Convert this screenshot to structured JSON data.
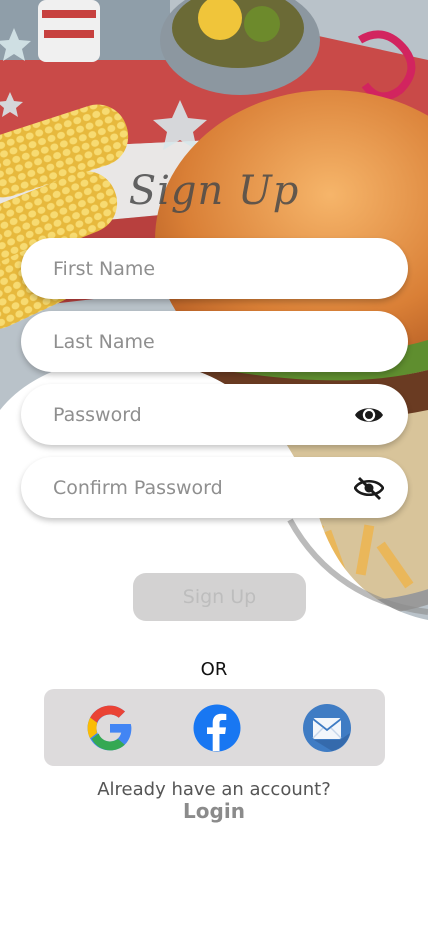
{
  "title": "Sign Up",
  "form": {
    "first_name_placeholder": "First Name",
    "last_name_placeholder": "Last Name",
    "password_placeholder": "Password",
    "confirm_password_placeholder": "Confirm Password",
    "password_icon": "eye-icon",
    "confirm_password_icon": "eye-slash-icon"
  },
  "buttons": {
    "signup_label": "Sign Up"
  },
  "divider": "OR",
  "social": {
    "icons": [
      "google-icon",
      "facebook-icon",
      "mail-icon"
    ]
  },
  "footer": {
    "account_text": "Already have an account?",
    "login_label": "Login"
  },
  "colors": {
    "button_bg": "#d3d2d2",
    "button_text": "#bdbdbd",
    "social_bg": "#dddbdc",
    "facebook_blue": "#1877f2",
    "mail_blue": "#3f7cc4"
  }
}
